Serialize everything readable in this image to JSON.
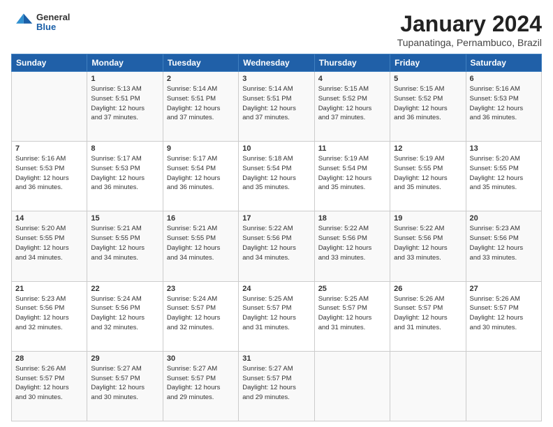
{
  "header": {
    "logo_general": "General",
    "logo_blue": "Blue",
    "title": "January 2024",
    "location": "Tupanatinga, Pernambuco, Brazil"
  },
  "columns": [
    "Sunday",
    "Monday",
    "Tuesday",
    "Wednesday",
    "Thursday",
    "Friday",
    "Saturday"
  ],
  "weeks": [
    [
      {
        "day": "",
        "info": ""
      },
      {
        "day": "1",
        "info": "Sunrise: 5:13 AM\nSunset: 5:51 PM\nDaylight: 12 hours\nand 37 minutes."
      },
      {
        "day": "2",
        "info": "Sunrise: 5:14 AM\nSunset: 5:51 PM\nDaylight: 12 hours\nand 37 minutes."
      },
      {
        "day": "3",
        "info": "Sunrise: 5:14 AM\nSunset: 5:51 PM\nDaylight: 12 hours\nand 37 minutes."
      },
      {
        "day": "4",
        "info": "Sunrise: 5:15 AM\nSunset: 5:52 PM\nDaylight: 12 hours\nand 37 minutes."
      },
      {
        "day": "5",
        "info": "Sunrise: 5:15 AM\nSunset: 5:52 PM\nDaylight: 12 hours\nand 36 minutes."
      },
      {
        "day": "6",
        "info": "Sunrise: 5:16 AM\nSunset: 5:53 PM\nDaylight: 12 hours\nand 36 minutes."
      }
    ],
    [
      {
        "day": "7",
        "info": "Sunrise: 5:16 AM\nSunset: 5:53 PM\nDaylight: 12 hours\nand 36 minutes."
      },
      {
        "day": "8",
        "info": "Sunrise: 5:17 AM\nSunset: 5:53 PM\nDaylight: 12 hours\nand 36 minutes."
      },
      {
        "day": "9",
        "info": "Sunrise: 5:17 AM\nSunset: 5:54 PM\nDaylight: 12 hours\nand 36 minutes."
      },
      {
        "day": "10",
        "info": "Sunrise: 5:18 AM\nSunset: 5:54 PM\nDaylight: 12 hours\nand 35 minutes."
      },
      {
        "day": "11",
        "info": "Sunrise: 5:19 AM\nSunset: 5:54 PM\nDaylight: 12 hours\nand 35 minutes."
      },
      {
        "day": "12",
        "info": "Sunrise: 5:19 AM\nSunset: 5:55 PM\nDaylight: 12 hours\nand 35 minutes."
      },
      {
        "day": "13",
        "info": "Sunrise: 5:20 AM\nSunset: 5:55 PM\nDaylight: 12 hours\nand 35 minutes."
      }
    ],
    [
      {
        "day": "14",
        "info": "Sunrise: 5:20 AM\nSunset: 5:55 PM\nDaylight: 12 hours\nand 34 minutes."
      },
      {
        "day": "15",
        "info": "Sunrise: 5:21 AM\nSunset: 5:55 PM\nDaylight: 12 hours\nand 34 minutes."
      },
      {
        "day": "16",
        "info": "Sunrise: 5:21 AM\nSunset: 5:55 PM\nDaylight: 12 hours\nand 34 minutes."
      },
      {
        "day": "17",
        "info": "Sunrise: 5:22 AM\nSunset: 5:56 PM\nDaylight: 12 hours\nand 34 minutes."
      },
      {
        "day": "18",
        "info": "Sunrise: 5:22 AM\nSunset: 5:56 PM\nDaylight: 12 hours\nand 33 minutes."
      },
      {
        "day": "19",
        "info": "Sunrise: 5:22 AM\nSunset: 5:56 PM\nDaylight: 12 hours\nand 33 minutes."
      },
      {
        "day": "20",
        "info": "Sunrise: 5:23 AM\nSunset: 5:56 PM\nDaylight: 12 hours\nand 33 minutes."
      }
    ],
    [
      {
        "day": "21",
        "info": "Sunrise: 5:23 AM\nSunset: 5:56 PM\nDaylight: 12 hours\nand 32 minutes."
      },
      {
        "day": "22",
        "info": "Sunrise: 5:24 AM\nSunset: 5:56 PM\nDaylight: 12 hours\nand 32 minutes."
      },
      {
        "day": "23",
        "info": "Sunrise: 5:24 AM\nSunset: 5:57 PM\nDaylight: 12 hours\nand 32 minutes."
      },
      {
        "day": "24",
        "info": "Sunrise: 5:25 AM\nSunset: 5:57 PM\nDaylight: 12 hours\nand 31 minutes."
      },
      {
        "day": "25",
        "info": "Sunrise: 5:25 AM\nSunset: 5:57 PM\nDaylight: 12 hours\nand 31 minutes."
      },
      {
        "day": "26",
        "info": "Sunrise: 5:26 AM\nSunset: 5:57 PM\nDaylight: 12 hours\nand 31 minutes."
      },
      {
        "day": "27",
        "info": "Sunrise: 5:26 AM\nSunset: 5:57 PM\nDaylight: 12 hours\nand 30 minutes."
      }
    ],
    [
      {
        "day": "28",
        "info": "Sunrise: 5:26 AM\nSunset: 5:57 PM\nDaylight: 12 hours\nand 30 minutes."
      },
      {
        "day": "29",
        "info": "Sunrise: 5:27 AM\nSunset: 5:57 PM\nDaylight: 12 hours\nand 30 minutes."
      },
      {
        "day": "30",
        "info": "Sunrise: 5:27 AM\nSunset: 5:57 PM\nDaylight: 12 hours\nand 29 minutes."
      },
      {
        "day": "31",
        "info": "Sunrise: 5:27 AM\nSunset: 5:57 PM\nDaylight: 12 hours\nand 29 minutes."
      },
      {
        "day": "",
        "info": ""
      },
      {
        "day": "",
        "info": ""
      },
      {
        "day": "",
        "info": ""
      }
    ]
  ]
}
